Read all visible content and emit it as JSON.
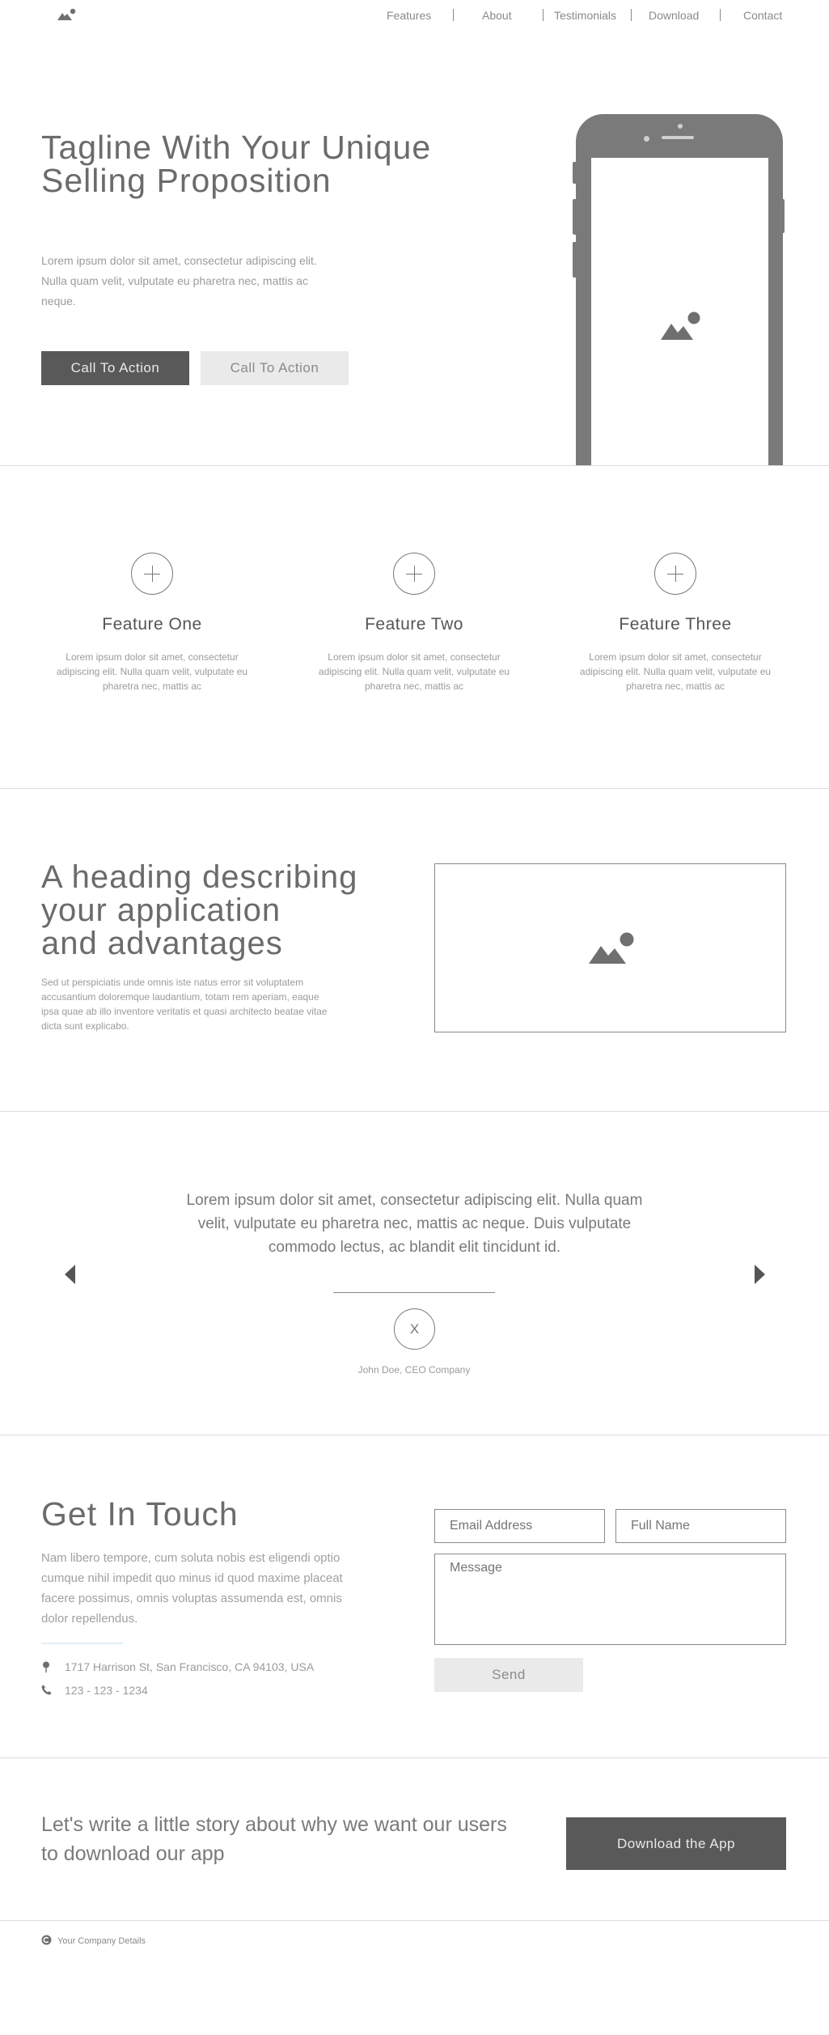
{
  "nav": {
    "items": [
      {
        "label": "Features"
      },
      {
        "label": "About"
      },
      {
        "label": "Testimonials"
      },
      {
        "label": "Download"
      },
      {
        "label": "Contact"
      }
    ]
  },
  "hero": {
    "title_line1": "Tagline With Your Unique",
    "title_line2": "Selling Proposition",
    "text": "Lorem ipsum dolor sit amet, consectetur adipiscing elit. Nulla quam velit, vulputate eu pharetra nec, mattis ac neque.",
    "cta_primary": "Call To Action",
    "cta_secondary": "Call To Action"
  },
  "features": [
    {
      "title": "Feature One",
      "text": "Lorem ipsum dolor sit amet, consectetur adipiscing elit. Nulla quam velit, vulputate eu pharetra nec, mattis ac"
    },
    {
      "title": "Feature Two",
      "text": "Lorem ipsum dolor sit amet, consectetur adipiscing elit. Nulla quam velit, vulputate eu pharetra nec, mattis ac"
    },
    {
      "title": "Feature Three",
      "text": "Lorem ipsum dolor sit amet, consectetur adipiscing elit. Nulla quam velit, vulputate eu pharetra nec, mattis ac"
    }
  ],
  "app": {
    "heading_line1": "A heading describing",
    "heading_line2": "your application",
    "heading_line3": "and advantages",
    "text": "Sed ut perspiciatis unde omnis iste natus error sit voluptatem accusantium doloremque laudantium, totam rem aperiam, eaque ipsa quae ab illo inventore veritatis et quasi architecto beatae vitae dicta sunt explicabo."
  },
  "testimonial": {
    "quote": "Lorem ipsum dolor sit amet, consectetur adipiscing elit. Nulla quam velit, vulputate eu pharetra nec, mattis ac neque. Duis vulputate commodo lectus, ac blandit elit tincidunt id.",
    "avatar_initial": "X",
    "author": "John Doe, CEO Company"
  },
  "contact": {
    "title": "Get In Touch",
    "text": "Nam libero tempore, cum soluta nobis est eligendi optio cumque nihil impedit quo minus id quod maxime placeat facere possimus, omnis voluptas assumenda est, omnis dolor repellendus.",
    "address": "1717 Harrison St, San Francisco, CA 94103, USA",
    "phone": "123 - 123 - 1234",
    "email_placeholder": "Email Address",
    "name_placeholder": "Full Name",
    "message_placeholder": "Message",
    "send_label": "Send"
  },
  "cta": {
    "text": "Let's write a little story about why we want our users to download our app",
    "button_label": "Download the App"
  },
  "footer": {
    "text": "Your Company Details"
  },
  "icons": {
    "logo": "mountain-logo-icon",
    "image": "image-placeholder-icon",
    "plus": "plus-icon",
    "prev": "chevron-left-icon",
    "next": "chevron-right-icon",
    "pin": "location-pin-icon",
    "phone": "phone-icon",
    "copyright": "copyright-icon"
  },
  "colors": {
    "dark_button": "#595959",
    "light_button": "#eaeaea",
    "phone": "#7a7a7a",
    "divider": "#dcdcdc"
  }
}
